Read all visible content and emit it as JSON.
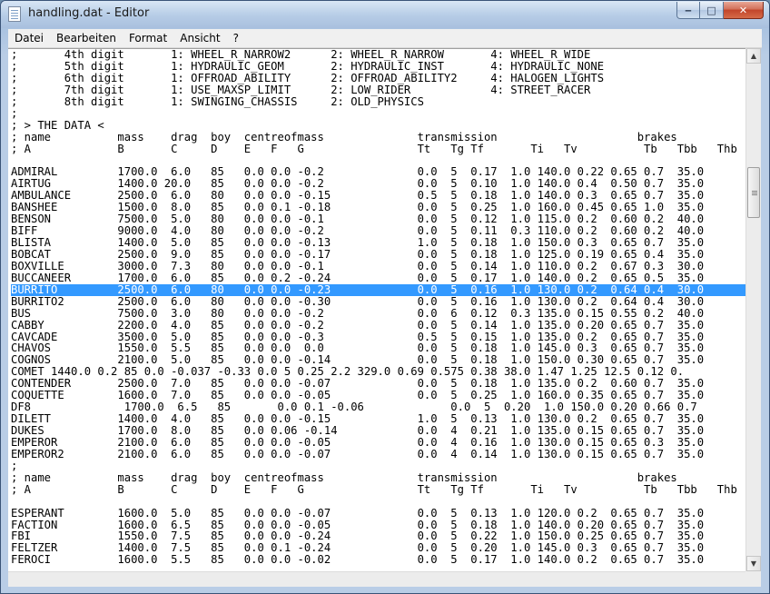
{
  "window": {
    "title": "handling.dat - Editor",
    "icon": "notepad-icon",
    "buttons": {
      "minimize": "minimize-icon",
      "maximize": "maximize-icon",
      "close": "close-icon"
    }
  },
  "menu": [
    "Datei",
    "Bearbeiten",
    "Format",
    "Ansicht",
    "?"
  ],
  "editor": {
    "selected_line": 20,
    "lines": [
      ";       4th digit       1: WHEEL_R_NARROW2      2: WHEEL_R_NARROW       4: WHEEL_R_WIDE",
      ";       5th digit       1: HYDRAULIC_GEOM       2: HYDRAULIC_INST       4: HYDRAULIC_NONE",
      ";       6th digit       1: OFFROAD_ABILITY      2: OFFROAD_ABILITY2     4: HALOGEN_LIGHTS",
      ";       7th digit       1: USE_MAXSP_LIMIT      2: LOW_RIDER            4: STREET_RACER",
      ";       8th digit       1: SWINGING_CHASSIS     2: OLD_PHYSICS",
      ";",
      "; > THE DATA <",
      "; name          mass    drag  boy  centreofmass              transmission                     brakes",
      "; A             B       C     D    E   F   G                 Tt   Tg Tf       Ti   Tv          Tb   Tbb   Thb",
      "",
      "ADMIRAL         1700.0  6.0   85   0.0 0.0 -0.2              0.0  5  0.17  1.0 140.0 0.22 0.65 0.7  35.0",
      "AIRTUG          1400.0 20.0   85   0.0 0.0 -0.2              0.0  5  0.10  1.0 140.0 0.4  0.50 0.7  35.0",
      "AMBULANCE       2500.0  6.0   80   0.0 0.0 -0.15             0.5  5  0.18  1.0 140.0 0.3  0.65 0.7  35.0",
      "BANSHEE         1500.0  8.0   85   0.0 0.1 -0.18             0.0  5  0.25  1.0 160.0 0.45 0.65 1.0  35.0",
      "BENSON          7500.0  5.0   80   0.0 0.0 -0.1              0.0  5  0.12  1.0 115.0 0.2  0.60 0.2  40.0",
      "BIFF            9000.0  4.0   80   0.0 0.0 -0.2              0.0  5  0.11  0.3 110.0 0.2  0.60 0.2  40.0",
      "BLISTA          1400.0  5.0   85   0.0 0.0 -0.13             1.0  5  0.18  1.0 150.0 0.3  0.65 0.7  35.0",
      "BOBCAT          2500.0  9.0   85   0.0 0.0 -0.17             0.0  5  0.18  1.0 125.0 0.19 0.65 0.4  35.0",
      "BOXVILLE        3000.0  7.3   80   0.0 0.0 -0.1              0.0  5  0.14  1.0 110.0 0.2  0.67 0.3  30.0",
      "BUCCANEER       1700.0  6.0   85   0.0 0.2 -0.24             0.0  5  0.17  1.0 140.0 0.2  0.65 0.5  35.0",
      "BURRITO         2500.0  6.0   80   0.0 0.0 -0.23             0.0  5  0.16  1.0 130.0 0.2  0.64 0.4  30.0",
      "BURRITO2        2500.0  6.0   80   0.0 0.0 -0.30             0.0  5  0.16  1.0 130.0 0.2  0.64 0.4  30.0",
      "BUS             7500.0  3.0   80   0.0 0.0 -0.2              0.0  6  0.12  0.3 135.0 0.15 0.55 0.2  40.0",
      "CABBY           2200.0  4.0   85   0.0 0.0 -0.2              0.0  5  0.14  1.0 135.0 0.20 0.65 0.7  35.0",
      "CAVCADE         3500.0  5.0   85   0.0 0.0 -0.3              0.5  5  0.15  1.0 135.0 0.2  0.65 0.7  35.0",
      "CHAVOS          1550.0  5.5   85   0.0 0.0  0.0              0.0  5  0.18  1.0 145.0 0.3  0.65 0.7  35.0",
      "COGNOS          2100.0  5.0   85   0.0 0.0 -0.14             0.0  5  0.18  1.0 150.0 0.30 0.65 0.7  35.0",
      "COMET 1440.0 0.2 85 0.0 -0.037 -0.33 0.0 5 0.25 2.2 329.0 0.69 0.575 0.38 38.0 1.47 1.25 12.5 0.12 0.",
      "CONTENDER       2500.0  7.0   85   0.0 0.0 -0.07             0.0  5  0.18  1.0 135.0 0.2  0.60 0.7  35.0",
      "COQUETTE        1600.0  7.0   85   0.0 0.0 -0.05             0.0  5  0.25  1.0 160.0 0.35 0.65 0.7  35.0",
      "DF8              1700.0  6.5   85       0.0 0.1 -0.06             0.0  5  0.20  1.0 150.0 0.20 0.66 0.7",
      "DILETT          1400.0  4.0   85   0.0 0.0 -0.15             1.0  5  0.13  1.0 130.0 0.2  0.65 0.7  35.0",
      "DUKES           1700.0  8.0   85   0.0 0.06 -0.14            0.0  4  0.21  1.0 135.0 0.15 0.65 0.7  35.0",
      "EMPEROR         2100.0  6.0   85   0.0 0.0 -0.05             0.0  4  0.16  1.0 130.0 0.15 0.65 0.3  35.0",
      "EMPEROR2        2100.0  6.0   85   0.0 0.0 -0.07             0.0  4  0.14  1.0 130.0 0.15 0.65 0.7  35.0",
      ";",
      "; name          mass    drag  boy  centreofmass              transmission                     brakes",
      "; A             B       C     D    E   F   G                 Tt   Tg Tf       Ti   Tv          Tb   Tbb   Thb",
      "",
      "ESPERANT        1600.0  5.0   85   0.0 0.0 -0.07             0.0  5  0.13  1.0 120.0 0.2  0.65 0.7  35.0",
      "FACTION         1600.0  6.5   85   0.0 0.0 -0.05             0.0  5  0.18  1.0 140.0 0.20 0.65 0.7  35.0",
      "FBI             1550.0  7.5   85   0.0 0.0 -0.24             0.0  5  0.22  1.0 150.0 0.25 0.65 0.7  35.0",
      "FELTZER         1400.0  7.5   85   0.0 0.1 -0.24             0.0  5  0.20  1.0 145.0 0.3  0.65 0.7  35.0",
      "FEROCI          1600.0  5.5   85   0.0 0.0 -0.02             0.0  5  0.17  1.0 140.0 0.2  0.65 0.7  35.0"
    ]
  },
  "scrollbar": {
    "up": "scroll-up-icon",
    "down": "scroll-down-icon"
  }
}
